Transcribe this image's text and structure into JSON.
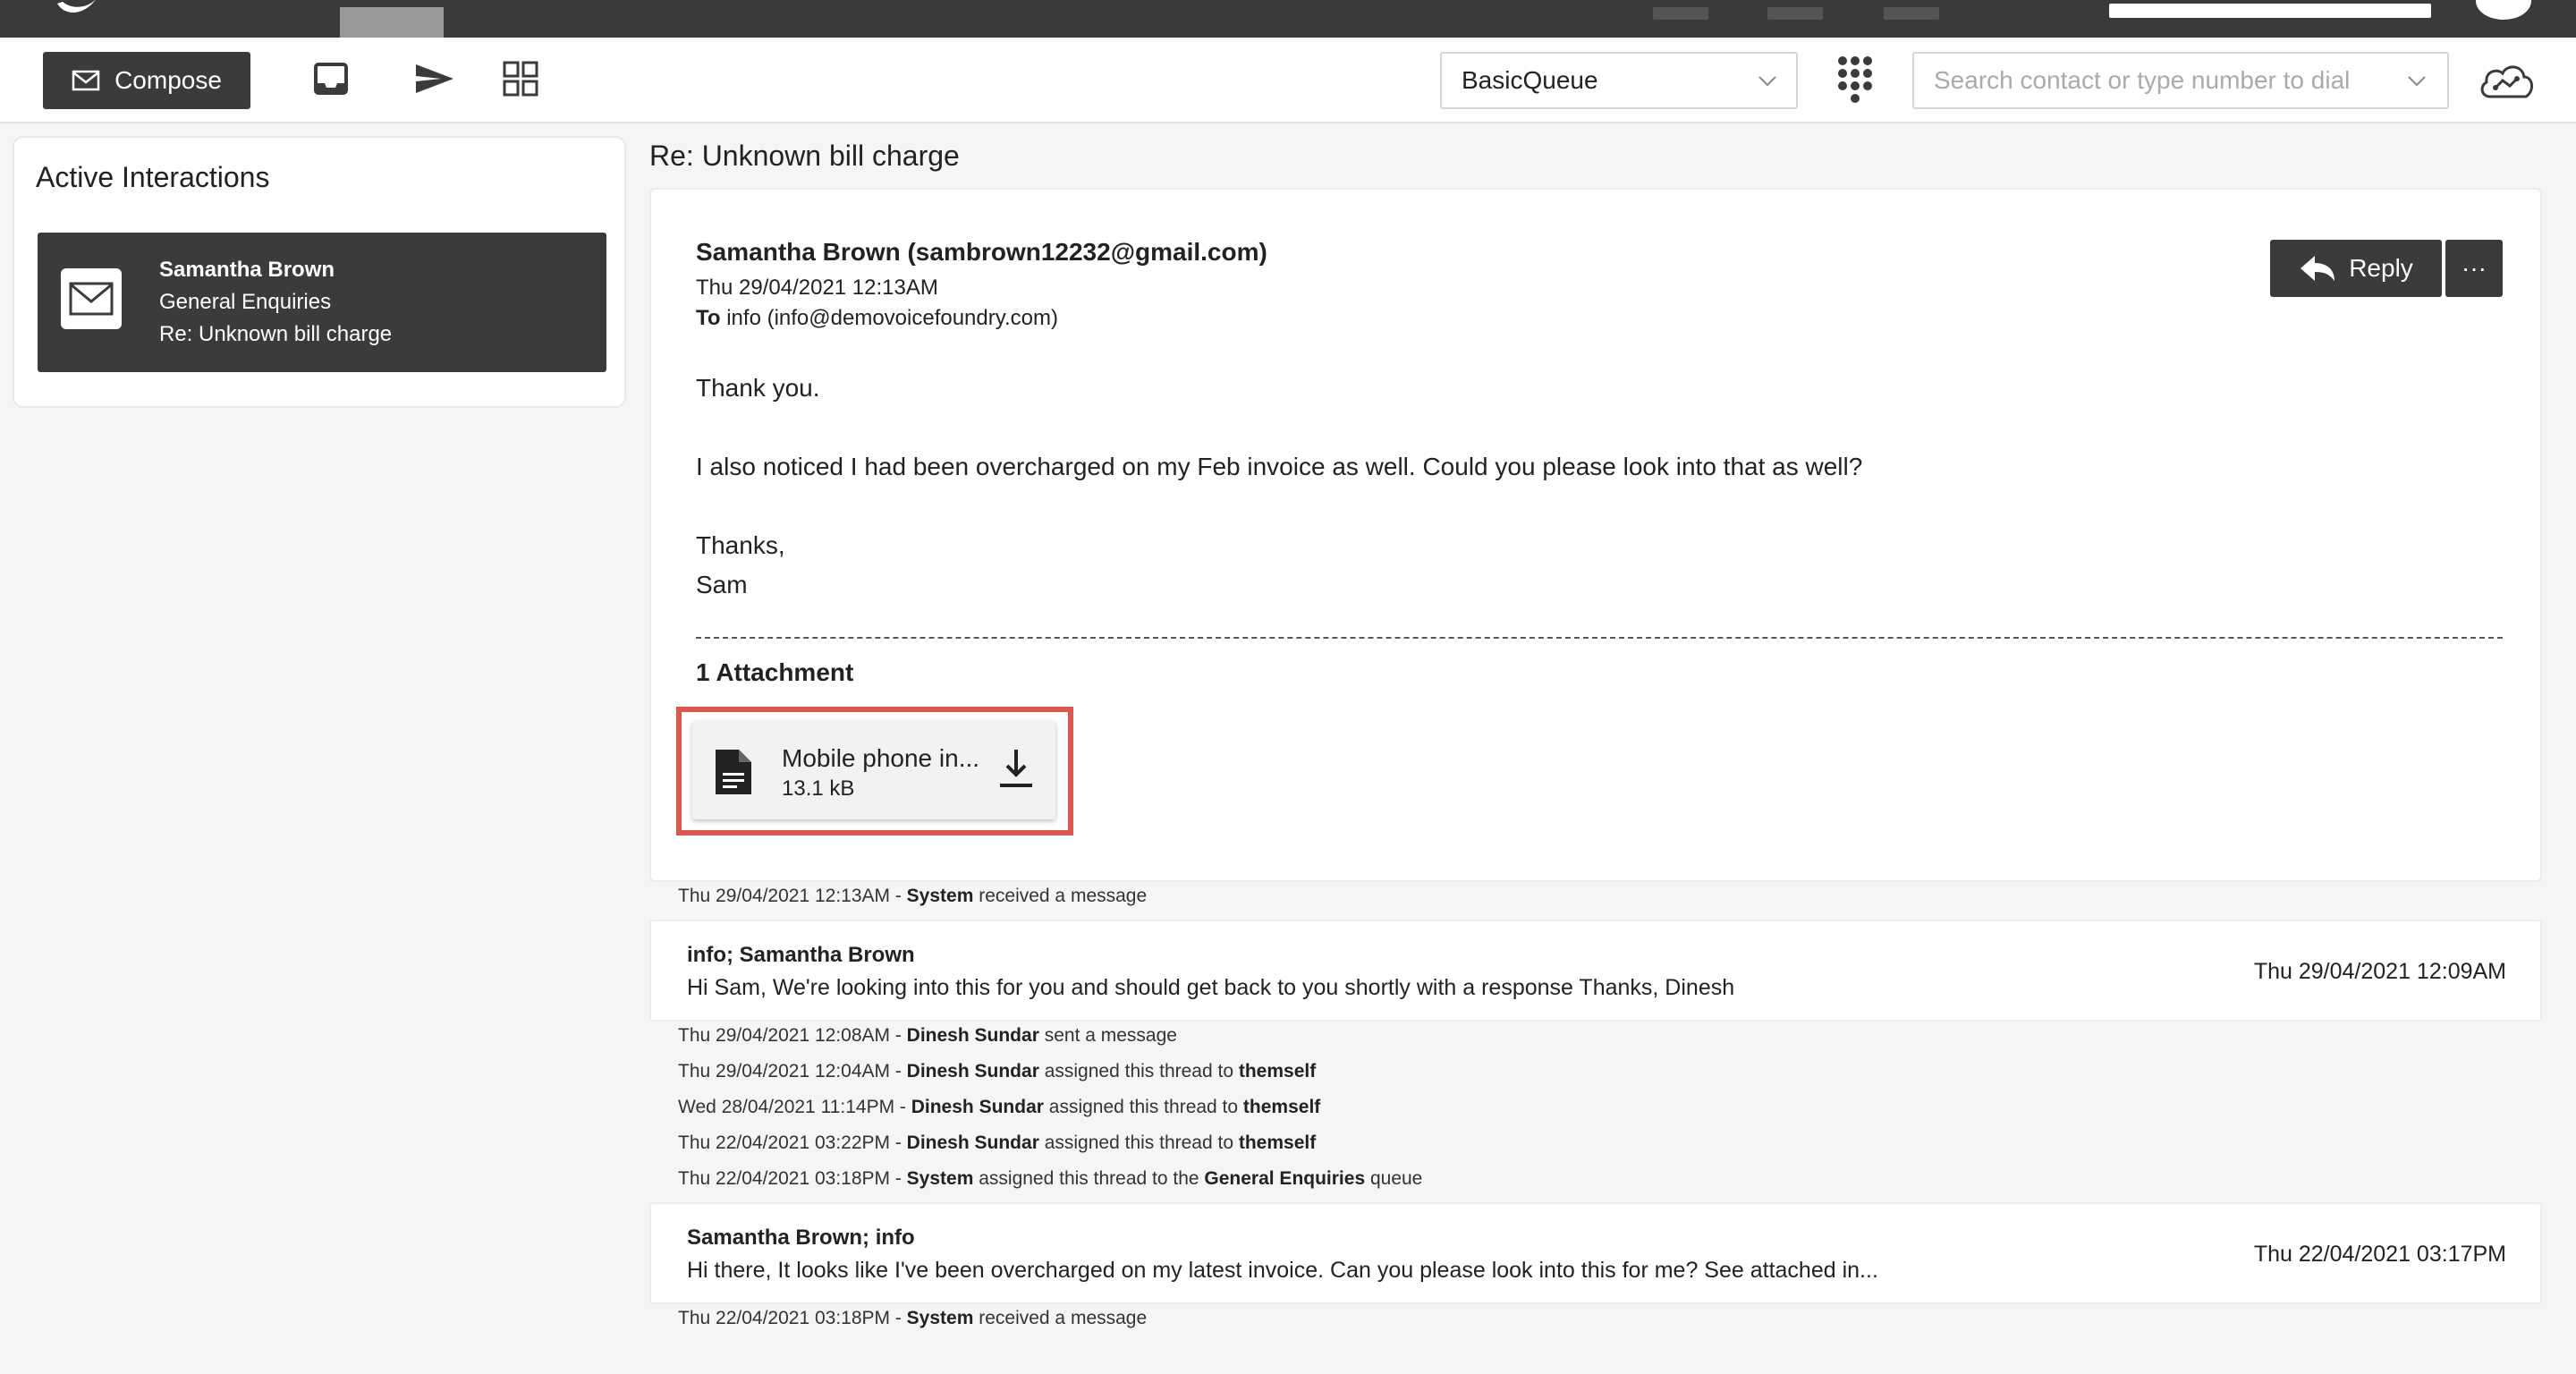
{
  "toolbar": {
    "compose_label": "Compose",
    "queue_value": "BasicQueue",
    "search_placeholder": "Search contact or type number to dial"
  },
  "left_panel": {
    "title": "Active Interactions",
    "interaction": {
      "name": "Samantha Brown",
      "queue": "General Enquiries",
      "subject": "Re: Unknown bill charge"
    }
  },
  "thread": {
    "subject": "Re: Unknown bill charge",
    "email": {
      "from": "Samantha Brown (sambrown12232@gmail.com)",
      "date": "Thu 29/04/2021 12:13AM",
      "to_label": "To",
      "to_value": "info (info@demovoicefoundry.com)",
      "reply_label": "Reply",
      "more_label": "···",
      "body": {
        "line1": "Thank you.",
        "line2": "I also noticed I had been overcharged on my Feb invoice as well. Could you please look into that as well?",
        "line3": "Thanks,",
        "line4": "Sam"
      },
      "attachments_title": "1 Attachment",
      "attachment": {
        "name": "Mobile phone in...",
        "size": "13.1 kB"
      }
    },
    "log1": {
      "time": "Thu 29/04/2021 12:13AM - ",
      "actor": "System",
      "text": " received a message"
    },
    "message2": {
      "participants": "info; Samantha Brown",
      "preview": "Hi Sam, We're looking into this for you and should get back to you shortly with a response Thanks, Dinesh",
      "time": "Thu 29/04/2021 12:09AM"
    },
    "log2": {
      "time": "Thu 29/04/2021 12:08AM - ",
      "actor": "Dinesh Sundar",
      "text": " sent a message"
    },
    "log3": {
      "time": "Thu 29/04/2021 12:04AM - ",
      "actor": "Dinesh Sundar",
      "text": " assigned this thread to ",
      "target": "themself"
    },
    "log4": {
      "time": "Wed 28/04/2021 11:14PM - ",
      "actor": "Dinesh Sundar",
      "text": " assigned this thread to ",
      "target": "themself"
    },
    "log5": {
      "time": "Thu 22/04/2021 03:22PM - ",
      "actor": "Dinesh Sundar",
      "text": " assigned this thread to ",
      "target": "themself"
    },
    "log6": {
      "time": "Thu 22/04/2021 03:18PM - ",
      "actor": "System",
      "text": " assigned this thread to the ",
      "target": "General Enquiries",
      "suffix": " queue"
    },
    "message3": {
      "participants": "Samantha Brown; info",
      "preview": "Hi there, It looks like I've been overcharged on my latest invoice. Can you please look into this for me? See attached in...",
      "time": "Thu 22/04/2021 03:17PM"
    },
    "log7": {
      "time": "Thu 22/04/2021 03:18PM - ",
      "actor": "System",
      "text": " received a message"
    }
  },
  "colors": {
    "dark": "#3b3b3b",
    "highlight": "#e0564a",
    "background": "#f5f5f5"
  }
}
